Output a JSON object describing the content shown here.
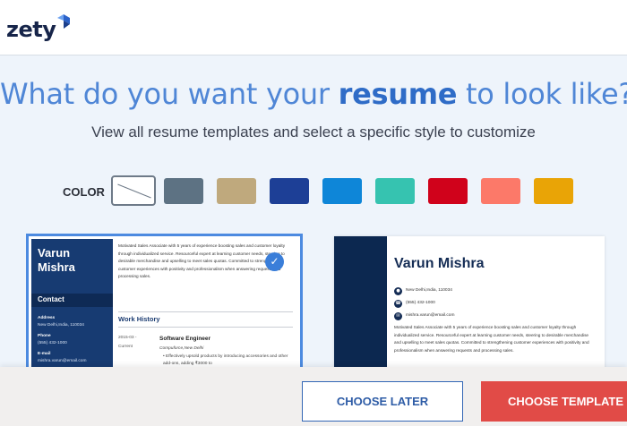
{
  "brand": {
    "name": "zety"
  },
  "hero": {
    "title_before": "What do you want your ",
    "title_bold": "resume",
    "title_after": " to look like?",
    "subtitle": "View all resume templates and select a specific style to customize"
  },
  "colors": {
    "label": "COLOR",
    "swatches": [
      {
        "name": "none",
        "hex": "#ffffff",
        "selected": true
      },
      {
        "name": "slate",
        "hex": "#5d7283"
      },
      {
        "name": "tan",
        "hex": "#bfa97d"
      },
      {
        "name": "navy",
        "hex": "#1d3f96"
      },
      {
        "name": "blue",
        "hex": "#0e86d8"
      },
      {
        "name": "teal",
        "hex": "#36c3b0"
      },
      {
        "name": "red",
        "hex": "#d0021b"
      },
      {
        "name": "salmon",
        "hex": "#fc7969"
      },
      {
        "name": "gold",
        "hex": "#e9a406"
      }
    ]
  },
  "templates": [
    {
      "name": "Varun Mishra",
      "first": "Varun",
      "last": "Mishra",
      "selected": true,
      "contact_heading": "Contact",
      "address_label": "Address",
      "address_value": "New Delhi,India, 110034",
      "phone_label": "Phone",
      "phone_value": "(555) 432-1000",
      "email_label": "E-mail",
      "email_value": "mishra.varun@email.com",
      "summary": "Motivated Sales Associate with 5 years of experience boosting sales and customer loyalty through individualized service. Resourceful expert at learning customer needs, steering to desirable merchandise and upselling to meet sales quotas. Committed to strengthening customer experiences with positivity and professionalism when answering requests and processing sales.",
      "work_history_heading": "Work History",
      "job_date_start": "2015-03 -",
      "job_date_end": "Current",
      "job_title": "Software Engineer",
      "job_company": "Compuforce,New Delhi",
      "job_bullet": "Effectively upsold products by introducing accessories and other add-ons, adding ₹3000 to"
    },
    {
      "name": "Varun Mishra",
      "address": "New Delhi,India, 110034",
      "phone": "(555) 432-1000",
      "email": "mishra.varun@email.com",
      "summary": "Motivated Sales Associate with 5 years of experience boosting sales and customer loyalty through individualized service. Resourceful expert at learning customer needs, steering to desirable merchandise and upselling to meet sales quotas. Committed to strengthening customer experiences with positivity and professionalism when answering requests and processing sales."
    }
  ],
  "footer": {
    "later_label": "CHOOSE LATER",
    "choose_label": "CHOOSE TEMPLATE"
  },
  "theme": {
    "accent": "#4c8ae0",
    "primary_button": "#e14b47",
    "secondary_button_text": "#2e5ca6"
  }
}
